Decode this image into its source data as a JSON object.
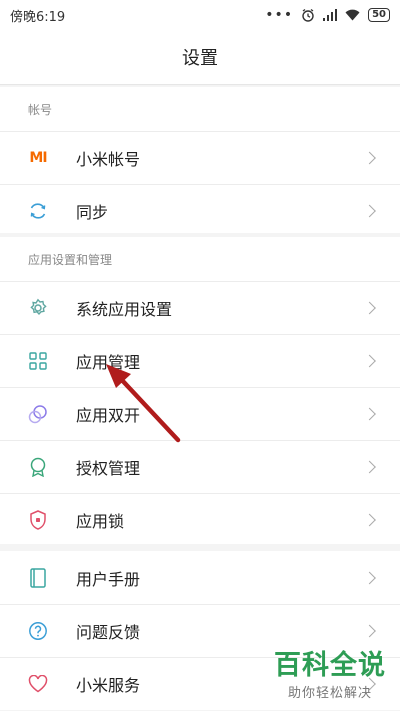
{
  "status_bar": {
    "time": "傍晚6:19",
    "battery": "50",
    "signal_icons": [
      "dots-icon",
      "alarm-icon",
      "signal-icon",
      "wifi-icon",
      "battery-icon"
    ]
  },
  "page_title": "设置",
  "sections": [
    {
      "header": "帐号",
      "items": [
        {
          "label": "小米帐号",
          "icon": "mi-logo-icon"
        },
        {
          "label": "同步",
          "icon": "sync-icon"
        }
      ]
    },
    {
      "header": "应用设置和管理",
      "items": [
        {
          "label": "系统应用设置",
          "icon": "gear-icon"
        },
        {
          "label": "应用管理",
          "icon": "grid-icon"
        },
        {
          "label": "应用双开",
          "icon": "dual-circle-icon"
        },
        {
          "label": "授权管理",
          "icon": "badge-icon"
        },
        {
          "label": "应用锁",
          "icon": "shield-lock-icon"
        }
      ]
    },
    {
      "header": "",
      "items": [
        {
          "label": "用户手册",
          "icon": "book-icon"
        },
        {
          "label": "问题反馈",
          "icon": "question-icon"
        },
        {
          "label": "小米服务",
          "icon": "heart-icon"
        }
      ]
    }
  ],
  "colors": {
    "accent_orange": "#f56a00",
    "icon_teal": "#3aa6a0",
    "icon_purple": "#8c7be8",
    "icon_red": "#e0506a",
    "arrow_red": "#b01c1c",
    "watermark_green": "#2e9d55"
  },
  "watermark": {
    "title": "百科全说",
    "subtitle": "助你轻松解决"
  }
}
